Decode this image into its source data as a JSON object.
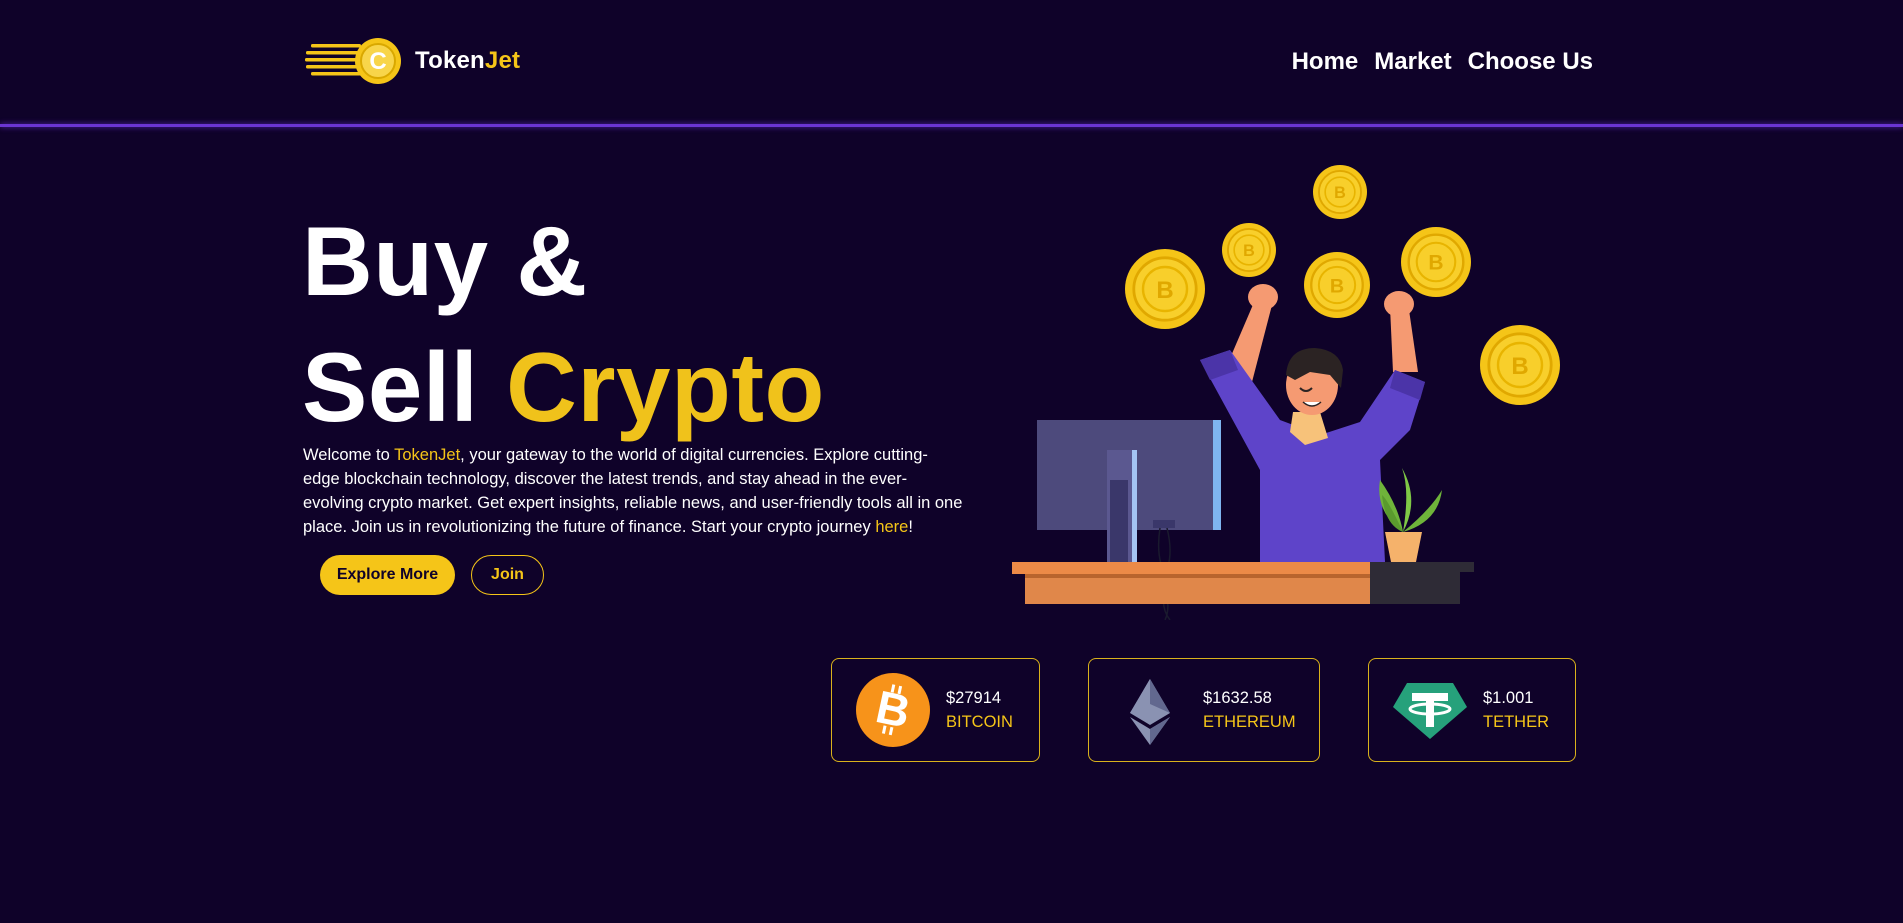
{
  "header": {
    "logo_text_main": "Token",
    "logo_text_accent": "Jet",
    "nav": [
      "Home",
      "Market",
      "Choose Us"
    ]
  },
  "hero": {
    "title_line1": "Buy &",
    "title_line2_plain": "Sell ",
    "title_line2_accent": "Crypto",
    "text_intro": "Welcome to ",
    "text_brand": "TokenJet",
    "text_body": ", your gateway to the world of digital currencies. Explore cutting-edge blockchain technology, discover the latest trends, and stay ahead in the ever-evolving crypto market. Get expert insights, reliable news, and user-friendly tools all in one place. Join us in revolutionizing the future of finance. Start your crypto journey ",
    "text_link": "here",
    "text_end": "!",
    "buttons": {
      "explore": "Explore More",
      "join": "Join"
    }
  },
  "coins": [
    {
      "price": "$27914",
      "name": "BITCOIN",
      "icon": "bitcoin-icon",
      "color": "#f7931a"
    },
    {
      "price": "$1632.58",
      "name": "ETHEREUM",
      "icon": "ethereum-icon",
      "color": "#8a92b2"
    },
    {
      "price": "$1.001",
      "name": "TETHER",
      "icon": "tether-icon",
      "color": "#26a17b"
    }
  ],
  "colors": {
    "background": "#0f0229",
    "accent": "#f5c518",
    "header_line": "#6a35d1"
  }
}
